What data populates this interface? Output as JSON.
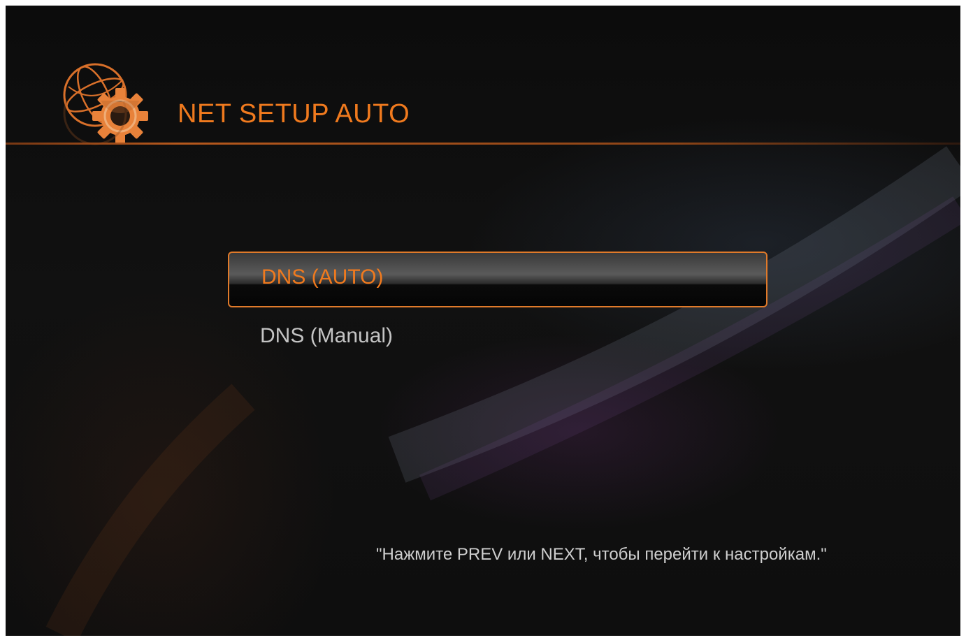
{
  "header": {
    "title": "NET SETUP AUTO",
    "icon": "network-settings-icon"
  },
  "menu": {
    "items": [
      {
        "label": "DNS (AUTO)",
        "selected": true
      },
      {
        "label": "DNS (Manual)",
        "selected": false
      }
    ]
  },
  "footer": {
    "hint": "\"Нажмите PREV или NEXT, чтобы перейти к настройкам.\""
  },
  "colors": {
    "accent": "#f07a1e",
    "background": "#0f0f0f",
    "text": "#c4c4c4"
  }
}
